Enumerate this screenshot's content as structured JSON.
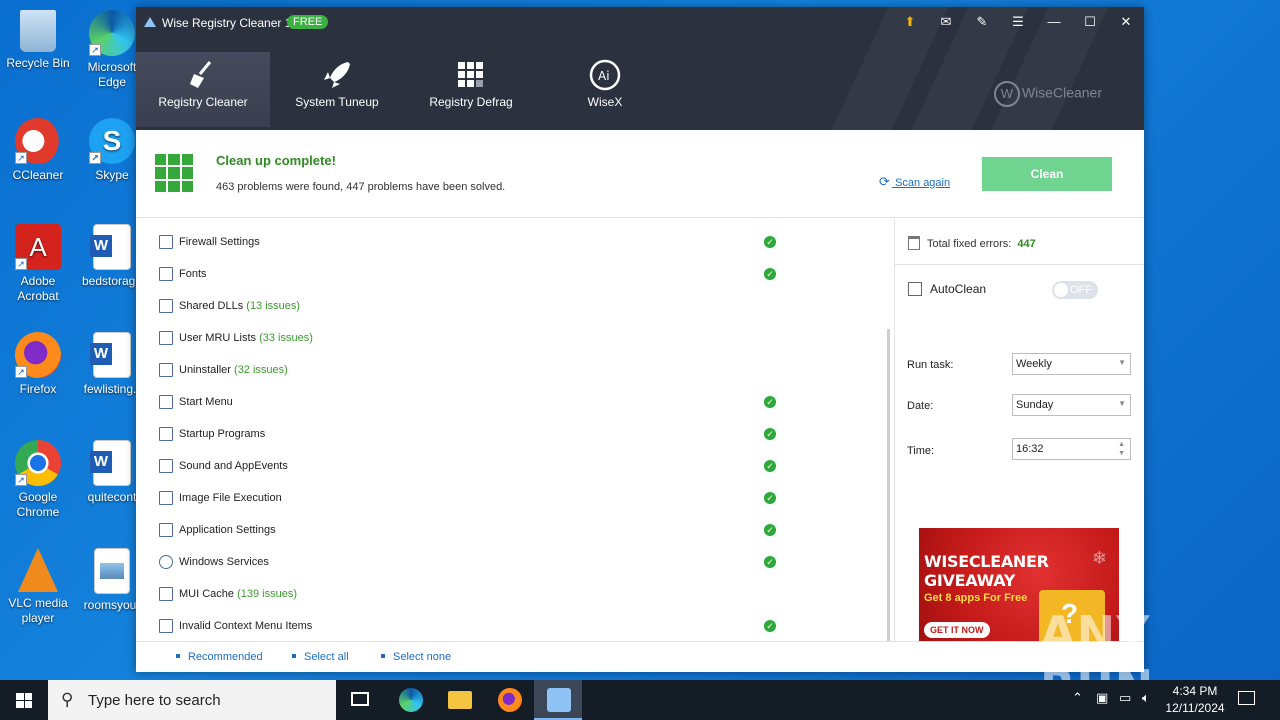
{
  "desktop": {
    "icons": [
      {
        "label": "Recycle Bin"
      },
      {
        "label": "Microsoft Edge"
      },
      {
        "label": "CCleaner"
      },
      {
        "label": "Skype"
      },
      {
        "label": "Adobe Acrobat"
      },
      {
        "label": "bedstorage"
      },
      {
        "label": "Firefox"
      },
      {
        "label": "fewlisting.r"
      },
      {
        "label": "Google Chrome"
      },
      {
        "label": "quitecont"
      },
      {
        "label": "VLC media player"
      },
      {
        "label": "roomsyour"
      }
    ]
  },
  "window": {
    "title": "Wise Registry Cleaner 11",
    "badge": "FREE",
    "tabs": [
      {
        "label": "Registry Cleaner"
      },
      {
        "label": "System Tuneup"
      },
      {
        "label": "Registry Defrag"
      },
      {
        "label": "WiseX"
      }
    ],
    "brand": "WiseCleaner"
  },
  "summary": {
    "title": "Clean up complete!",
    "subtitle": "463 problems were found, 447 problems have been solved.",
    "scan_again": "Scan again",
    "clean_button": "Clean"
  },
  "items": [
    {
      "label": "Firewall Settings",
      "issues": "",
      "ok": true
    },
    {
      "label": "Fonts",
      "issues": "",
      "ok": true
    },
    {
      "label": "Shared DLLs",
      "issues": "(13 issues)",
      "ok": false
    },
    {
      "label": "User MRU Lists",
      "issues": "(33 issues)",
      "ok": false
    },
    {
      "label": "Uninstaller",
      "issues": "(32 issues)",
      "ok": false
    },
    {
      "label": "Start Menu",
      "issues": "",
      "ok": true
    },
    {
      "label": "Startup Programs",
      "issues": "",
      "ok": true
    },
    {
      "label": "Sound and AppEvents",
      "issues": "",
      "ok": true
    },
    {
      "label": "Image File Execution",
      "issues": "",
      "ok": true
    },
    {
      "label": "Application Settings",
      "issues": "",
      "ok": true
    },
    {
      "label": "Windows Services",
      "issues": "",
      "ok": true
    },
    {
      "label": "MUI Cache",
      "issues": "(139 issues)",
      "ok": false
    },
    {
      "label": "Invalid Context Menu Items",
      "issues": "",
      "ok": true
    }
  ],
  "side": {
    "total_label": "Total fixed errors:",
    "total_value": "447",
    "autoclean_label": "AutoClean",
    "toggle_state": "OFF",
    "run_task_label": "Run task:",
    "run_task_value": "Weekly",
    "date_label": "Date:",
    "date_value": "Sunday",
    "time_label": "Time:",
    "time_value": "16:32",
    "ad": {
      "headline_1": "WISECLEANER",
      "headline_2": "GIVEAWAY",
      "subline": "Get 8 apps For Free",
      "cta": "GET IT NOW"
    }
  },
  "bottom": {
    "recommended": "Recommended",
    "select_all": "Select all",
    "select_none": "Select none"
  },
  "watermark": "ANY RUN",
  "taskbar": {
    "search_placeholder": "Type here to search",
    "time": "4:34 PM",
    "date": "12/11/2024"
  },
  "colors": {
    "header": "#2c3140",
    "success_green": "#2e8b1f",
    "clean_button": "#6fd48f",
    "link_blue": "#1d6fc1",
    "desktop_blue": "#1482dc"
  }
}
